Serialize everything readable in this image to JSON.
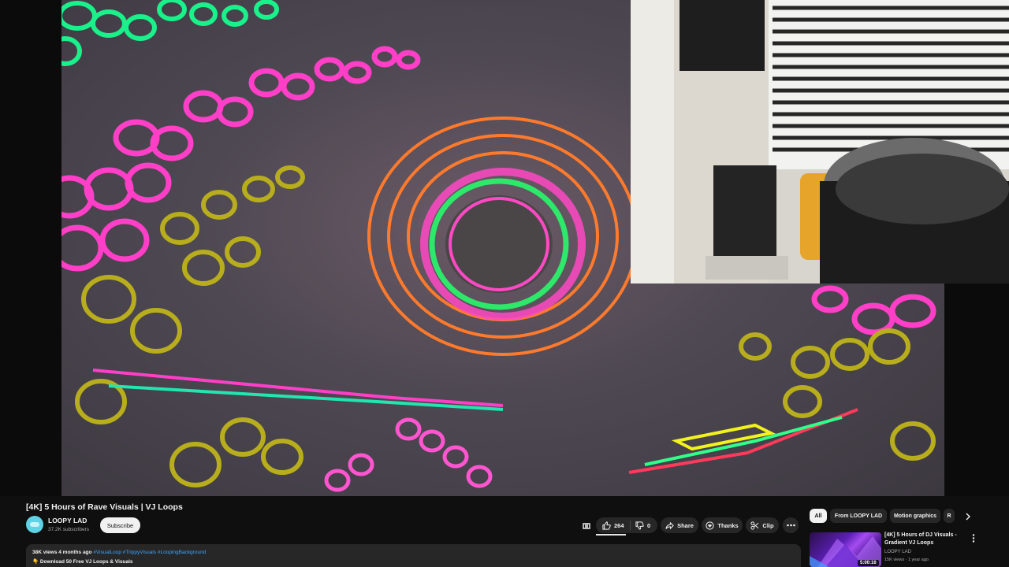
{
  "video": {
    "title": "[4K] 5 Hours of Rave Visuals | VJ Loops"
  },
  "channel": {
    "name": "LOOPY LAD",
    "subscribers": "37.2K subscribers",
    "subscribe_label": "Subscribe"
  },
  "actions": {
    "like_count": "264",
    "dislike_count": "0",
    "share_label": "Share",
    "thanks_label": "Thanks",
    "clip_label": "Clip"
  },
  "description": {
    "views_date": "38K views  4 months ago",
    "hashtags": "#VisualLoop #TrippyVisuals #LoopingBackground",
    "download_line": "👇 Download 50 Free VJ Loops & Visuals"
  },
  "right_rail": {
    "chips": [
      "All",
      "From LOOPY LAD",
      "Motion graphics",
      "R"
    ],
    "recommendation": {
      "title": "[4K] 5 Hours of DJ Visuals - Gradient VJ Loops",
      "channel": "LOOPY LAD",
      "meta": "15K views · 1 year ago",
      "duration": "5:00:16"
    }
  },
  "icons": {
    "like": "thumbs-up-icon",
    "dislike": "thumbs-down-icon",
    "share": "share-arrow-icon",
    "thanks": "thanks-heart-icon",
    "clip": "scissors-icon",
    "more": "more-horizontal-icon",
    "next": "chevron-right-icon",
    "kebab": "more-vertical-icon"
  },
  "colors": {
    "background": "#0f0f0f",
    "surface": "#272727",
    "link": "#3ea6ff",
    "text": "#f1f1f1",
    "muted": "#aaaaaa"
  }
}
